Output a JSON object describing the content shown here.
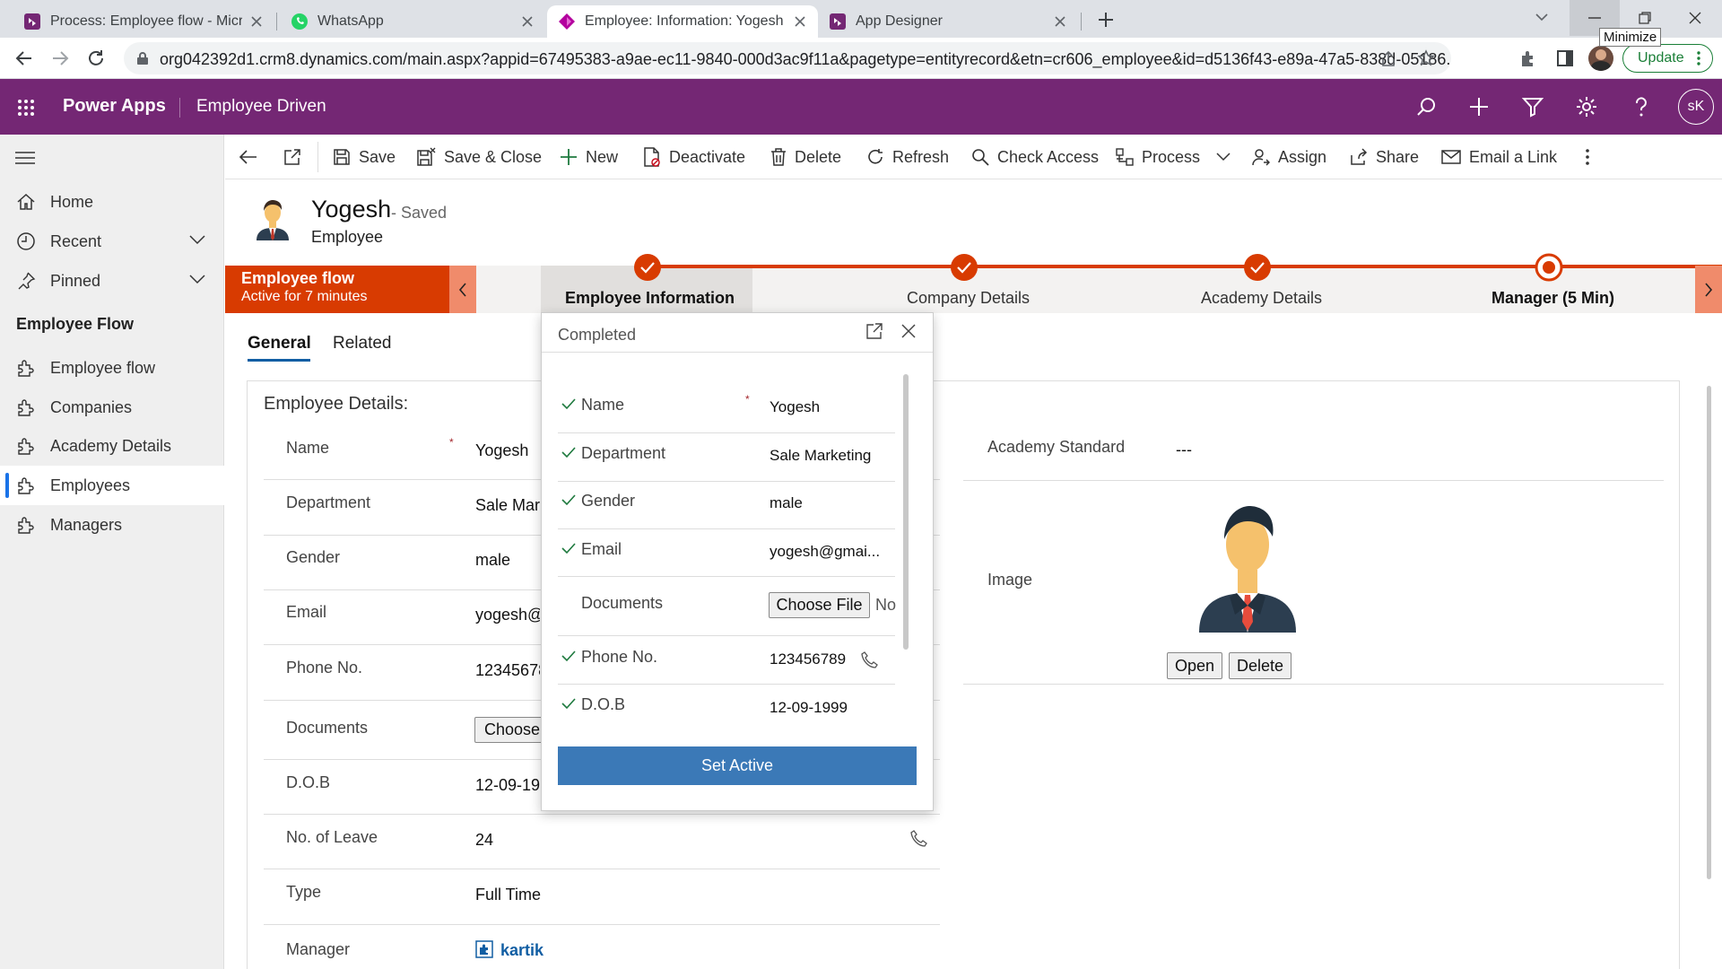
{
  "browser": {
    "tabs": [
      {
        "title": "Process: Employee flow - Microsoft",
        "favicon": "power-apps-icon"
      },
      {
        "title": "WhatsApp",
        "favicon": "whatsapp-icon"
      },
      {
        "title": "Employee: Information: Yogesh - Power Apps",
        "favicon": "power-apps-icon"
      },
      {
        "title": "App Designer",
        "favicon": "power-apps-icon"
      }
    ],
    "url": "org042392d1.crm8.dynamics.com/main.aspx?appid=67495383-a9ae-ec11-9840-000d3ac9f11a&pagetype=entityrecord&etn=cr606_employee&id=d5136f43-e89a-47a5-838d-05186...",
    "tooltip": "Minimize",
    "update_label": "Update"
  },
  "app": {
    "name": "Power Apps",
    "env": "Employee Driven",
    "user_initials": "sK"
  },
  "sidebar": {
    "items": [
      {
        "label": "Home",
        "icon": "home-icon"
      },
      {
        "label": "Recent",
        "icon": "clock-icon"
      },
      {
        "label": "Pinned",
        "icon": "pin-icon"
      }
    ],
    "group_title": "Employee Flow",
    "entities": [
      {
        "label": "Employee flow"
      },
      {
        "label": "Companies"
      },
      {
        "label": "Academy Details"
      },
      {
        "label": "Employees"
      },
      {
        "label": "Managers"
      }
    ]
  },
  "commands": {
    "save": "Save",
    "save_close": "Save & Close",
    "new": "New",
    "deactivate": "Deactivate",
    "delete": "Delete",
    "refresh": "Refresh",
    "check_access": "Check Access",
    "process": "Process",
    "assign": "Assign",
    "share": "Share",
    "email_link": "Email a Link"
  },
  "record": {
    "name": "Yogesh",
    "status": "- Saved",
    "entity": "Employee"
  },
  "bpf": {
    "flow_name": "Employee flow",
    "flow_status": "Active for 7 minutes",
    "stages": [
      {
        "label": "Employee Information",
        "state": "completed"
      },
      {
        "label": "Company Details",
        "state": "completed"
      },
      {
        "label": "Academy Details",
        "state": "completed"
      },
      {
        "label": "Manager  (5 Min)",
        "state": "active"
      }
    ]
  },
  "form_tabs": {
    "general": "General",
    "related": "Related"
  },
  "section": {
    "title": "Employee Details:",
    "required_mark": "*",
    "fields": [
      {
        "label": "Name",
        "value": "Yogesh"
      },
      {
        "label": "Department",
        "value": "Sale Marketing"
      },
      {
        "label": "Gender",
        "value": "male"
      },
      {
        "label": "Email",
        "value": "yogesh@gmail.com"
      },
      {
        "label": "Phone No.",
        "value": "123456789"
      },
      {
        "label": "Documents",
        "value": "Choose File"
      },
      {
        "label": "D.O.B",
        "value": "12-09-1999"
      },
      {
        "label": "No. of Leave",
        "value": "24"
      },
      {
        "label": "Type",
        "value": "Full Time"
      },
      {
        "label": "Manager",
        "value": "kartik"
      }
    ]
  },
  "right_section": {
    "academy_label": "Academy Standard",
    "academy_value": "---",
    "image_label": "Image",
    "open_btn": "Open",
    "delete_btn": "Delete"
  },
  "flyout": {
    "title": "Completed",
    "required_mark": "*",
    "fields": [
      {
        "label": "Name",
        "value": "Yogesh"
      },
      {
        "label": "Department",
        "value": "Sale Marketing"
      },
      {
        "label": "Gender",
        "value": "male"
      },
      {
        "label": "Email",
        "value": "yogesh@gmai..."
      },
      {
        "label": "Documents",
        "value": "Choose File",
        "extra": "No"
      },
      {
        "label": "Phone No.",
        "value": "123456789"
      },
      {
        "label": "D.O.B",
        "value": "12-09-1999"
      }
    ],
    "set_active": "Set Active"
  },
  "colors": {
    "brand": "#742774",
    "bpf_red": "#d83b01",
    "accent_blue": "#3b79b7",
    "link": "#115ea3"
  }
}
